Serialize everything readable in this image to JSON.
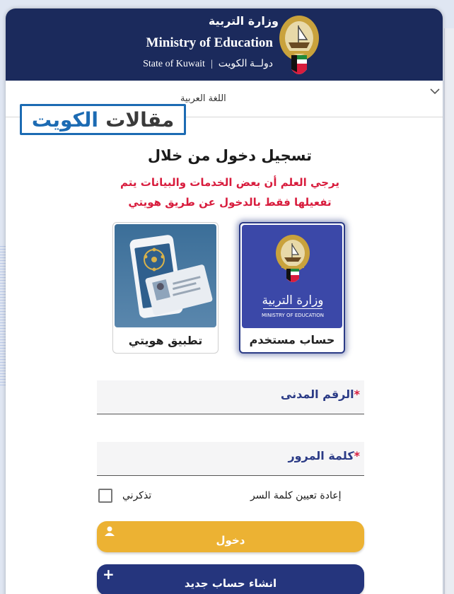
{
  "header": {
    "ministry_ar": "وزارة التربية",
    "ministry_en": "Ministry of Education",
    "state_en": "State of Kuwait",
    "separator": "|",
    "state_ar": "دولــة الكويت"
  },
  "language": {
    "selected": "اللغة العربية",
    "chevron_icon": "chevron-down-icon"
  },
  "watermark": {
    "part_dark": "مقالات",
    "part_blue": "الكويت"
  },
  "login": {
    "title": "تسجيل دخول من خلال",
    "notice_line1": "يرجي العلم أن بعض الخدمات والبيانات يتم",
    "notice_line2": "تفعيلها فقط بالدخول عن طريق هويتي",
    "options": [
      {
        "label": "تطبيق هويتي"
      },
      {
        "label": "حساب مستخدم",
        "card_ar": "وزارة التربية",
        "card_en": "MINISTRY OF EDUCATION"
      }
    ]
  },
  "form": {
    "civil_id_label": "الرقم المدنى",
    "password_label": "كلمة المرور",
    "required_mark": "*",
    "reset_password": "إعادة تعيين كلمة السر",
    "remember_me": "تذكرني",
    "login_button": "دخول",
    "register_button": "انشاء حساب جديد",
    "register_icon": "+"
  },
  "colors": {
    "header_bg": "#1b2a5c",
    "accent_red": "#d81c3d",
    "login_yellow": "#ecb233",
    "register_navy": "#25357d",
    "label_blue": "#2b3b86"
  }
}
